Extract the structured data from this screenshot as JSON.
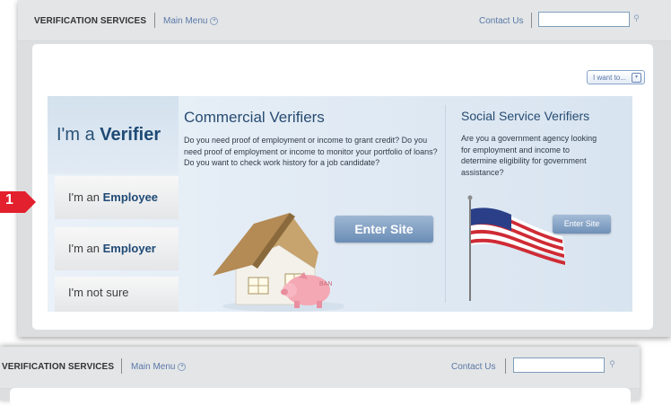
{
  "header": {
    "brand": "VERIFICATION SERVICES",
    "main_menu": "Main Menu",
    "contact_us": "Contact Us",
    "search_value": ""
  },
  "i_want_to": "I want to...",
  "verifier_prefix": "I'm a",
  "verifier_bold": "Verifier",
  "nav": [
    {
      "prefix": "I'm an",
      "bold": "Employee"
    },
    {
      "prefix": "I'm an",
      "bold": "Employer"
    },
    {
      "prefix": "I'm not sure",
      "bold": ""
    }
  ],
  "commercial": {
    "title": "Commercial Verifiers",
    "body": "Do you need proof of employment or income to grant credit? Do you need proof of employment or income to monitor your portfolio of loans? Do you want to check work history for a job candidate?",
    "button": "Enter Site"
  },
  "social": {
    "title": "Social Service Verifiers",
    "body": "Are you a government agency looking for employment and income to determine eligibility for government assistance?",
    "button": "Enter Site"
  },
  "callout_number": "1",
  "piggy_label": "BAN",
  "colors": {
    "accent": "#e3202d",
    "link": "#5a78a8",
    "heading": "#284c72",
    "button": "#7f9fc4"
  }
}
